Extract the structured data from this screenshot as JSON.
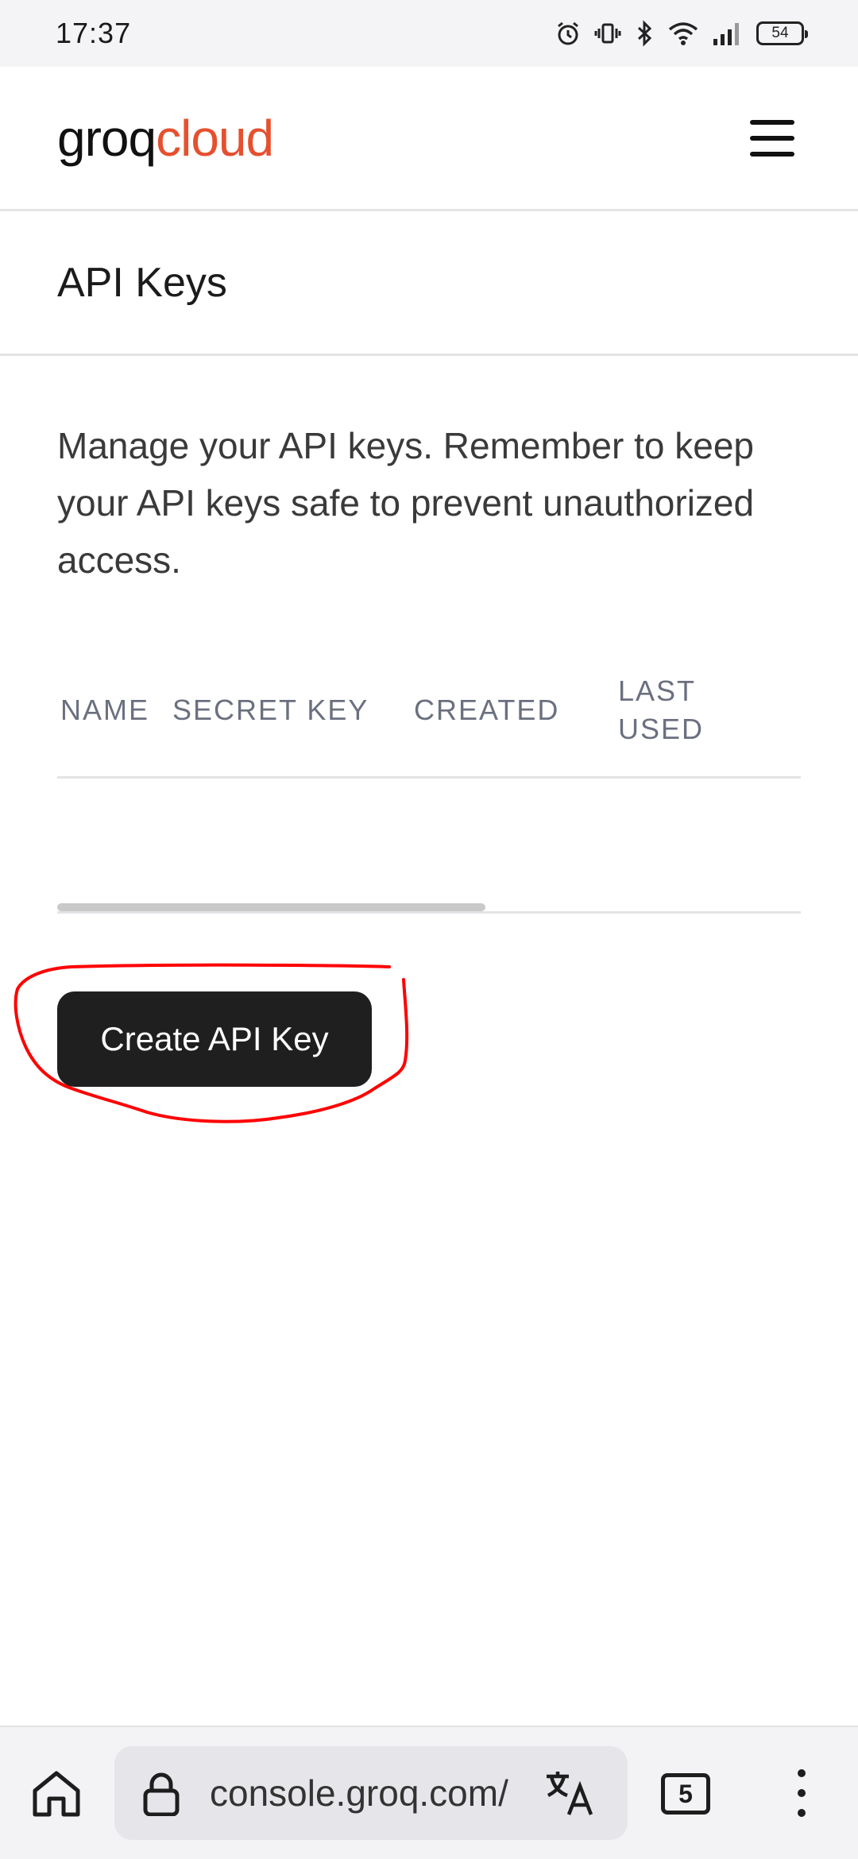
{
  "status_bar": {
    "time": "17:37",
    "battery": "54",
    "icons": [
      "alarm-icon",
      "vibrate-icon",
      "bluetooth-icon",
      "wifi-icon",
      "signal-icon",
      "battery-icon"
    ]
  },
  "header": {
    "logo_part1": "groq",
    "logo_part2": "cloud",
    "menu_icon": "hamburger-menu-icon"
  },
  "page": {
    "title": "API Keys",
    "description": "Manage your API keys. Remember to keep your API keys safe to prevent unauthorized access."
  },
  "table": {
    "columns": [
      "NAME",
      "SECRET KEY",
      "CREATED",
      "LAST USED"
    ],
    "rows": []
  },
  "actions": {
    "create_label": "Create API Key"
  },
  "browser": {
    "url": "console.groq.com/",
    "tab_count": "5",
    "icons": [
      "home-icon",
      "lock-icon",
      "translate-icon",
      "tabs-icon",
      "more-vert-icon"
    ]
  },
  "colors": {
    "brand_accent": "#e5502e",
    "button_bg": "#1f1f1f",
    "annotation": "#ff0000"
  }
}
